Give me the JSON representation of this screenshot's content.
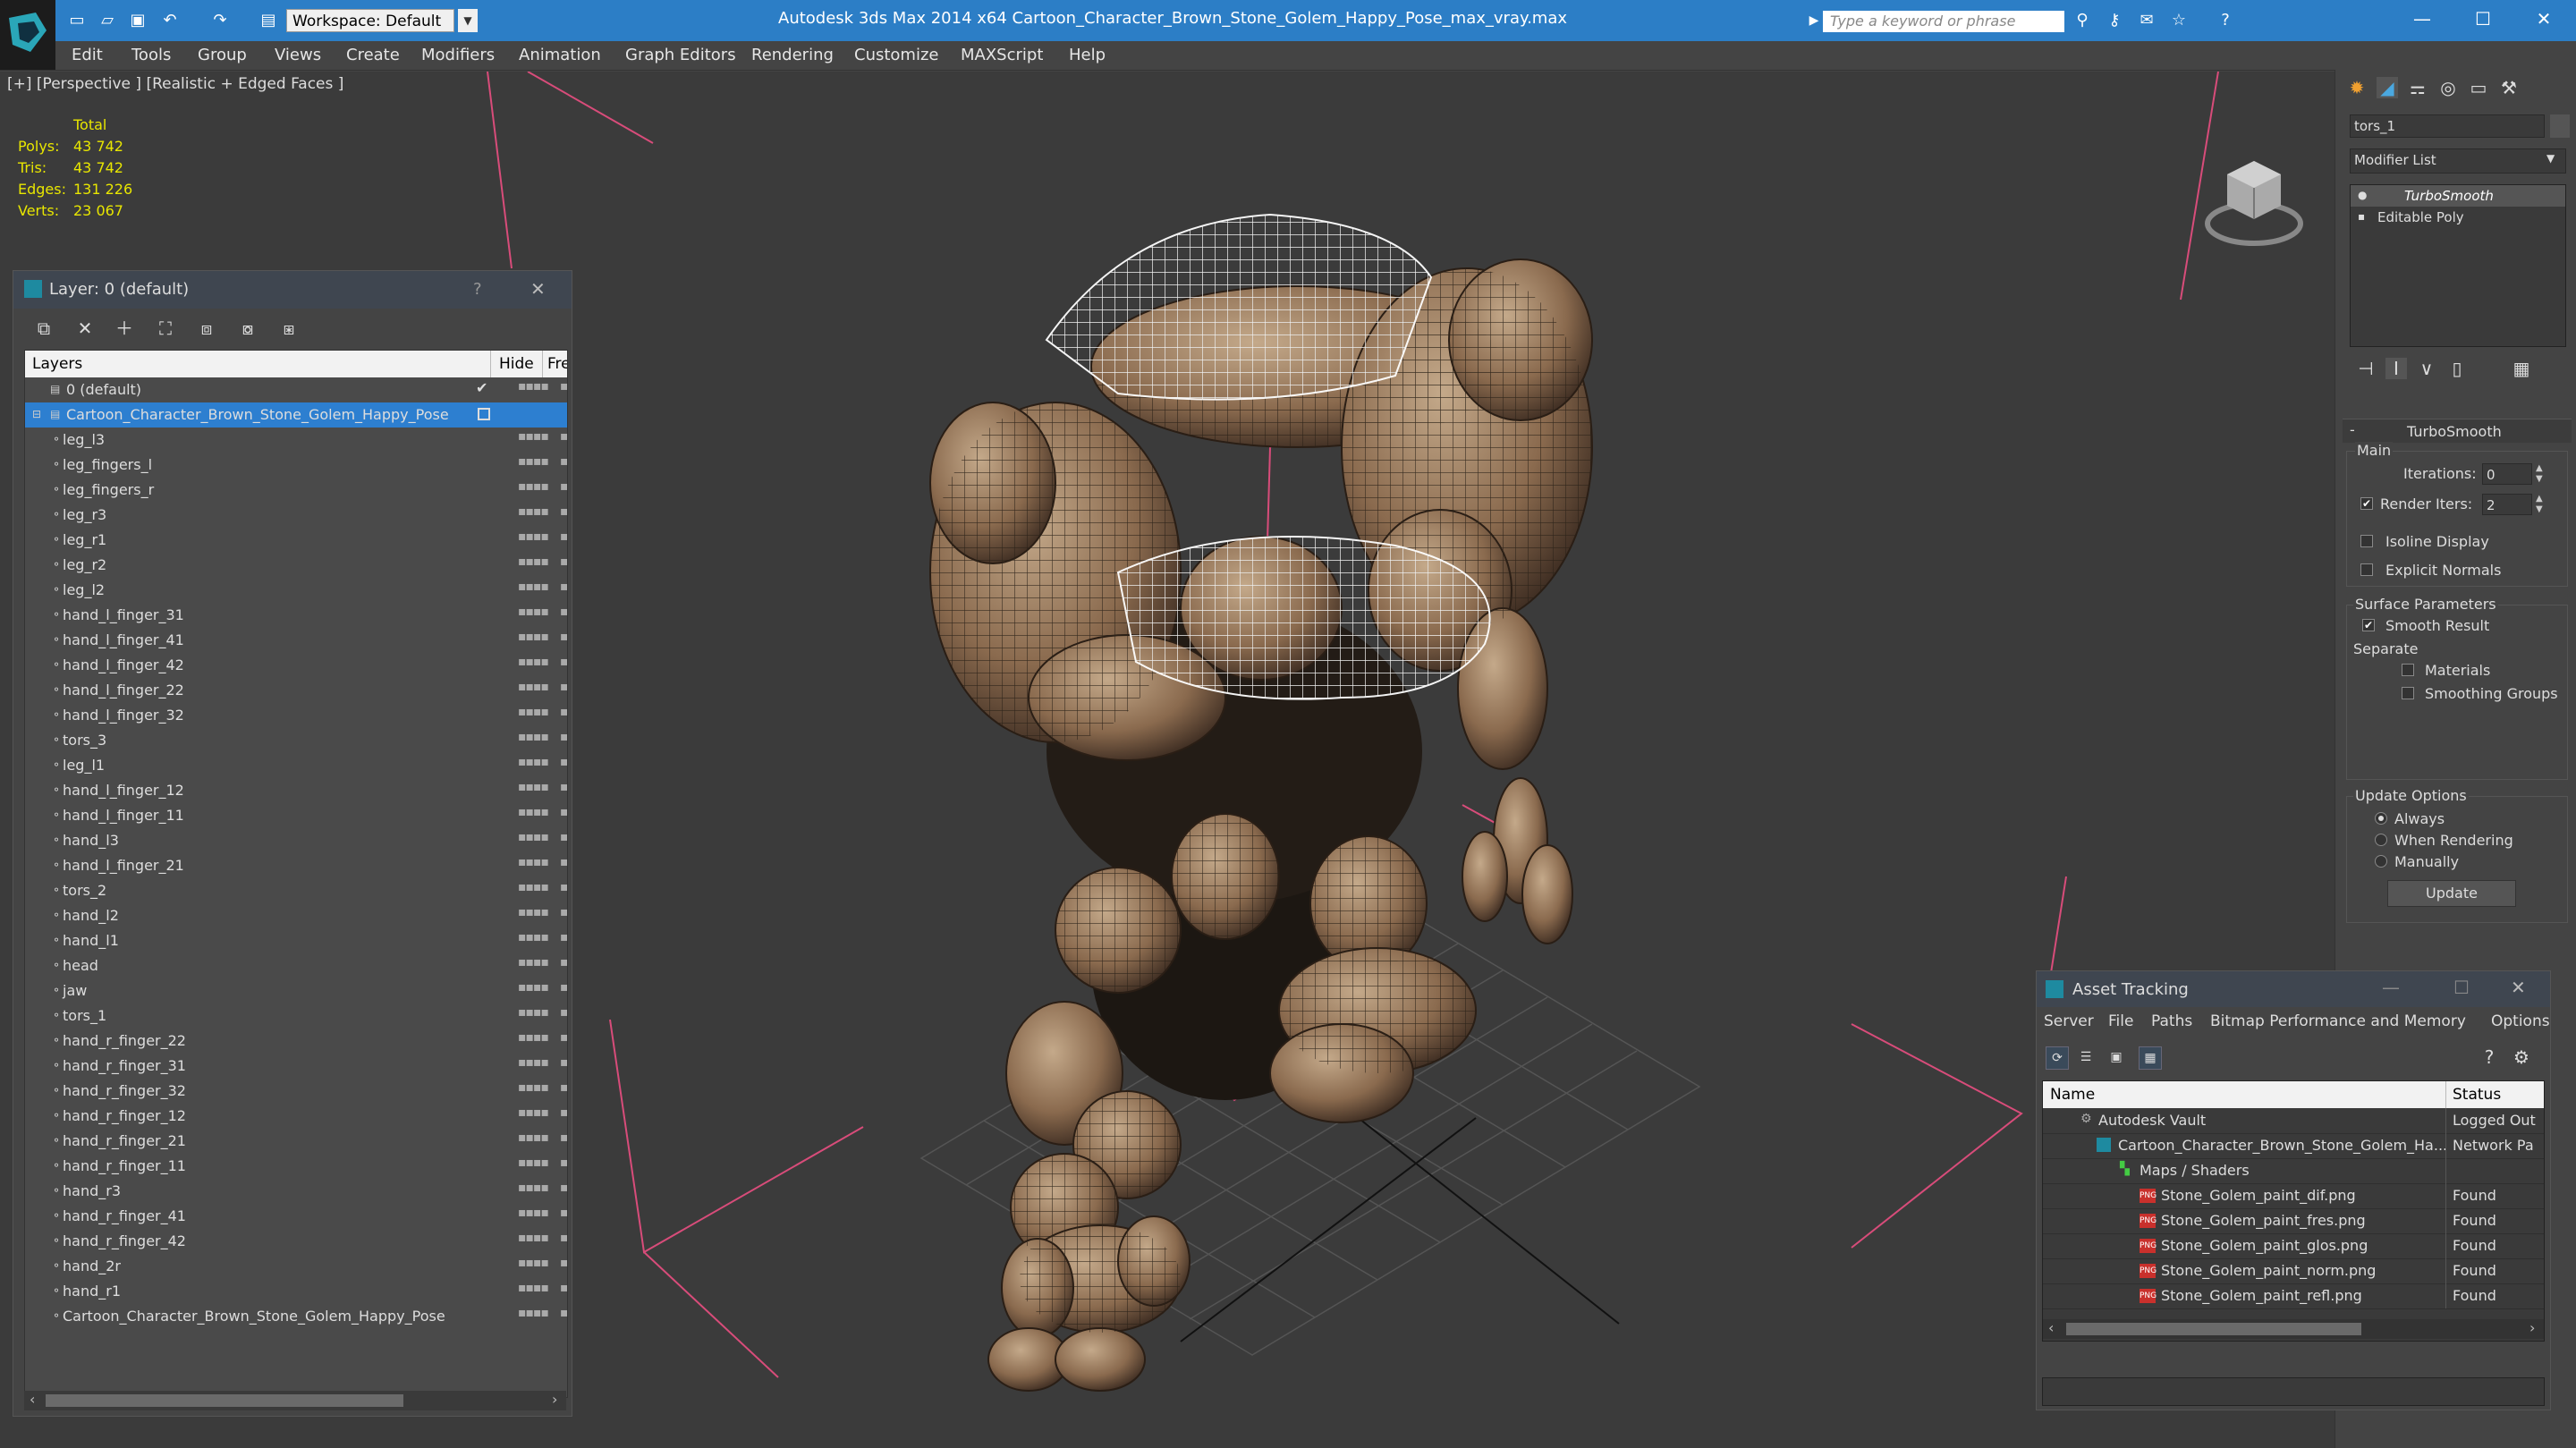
{
  "app": {
    "title": "Autodesk 3ds Max  2014 x64      Cartoon_Character_Brown_Stone_Golem_Happy_Pose_max_vray.max",
    "workspace": "Workspace: Default",
    "search_placeholder": "Type a keyword or phrase"
  },
  "menu": [
    "Edit",
    "Tools",
    "Group",
    "Views",
    "Create",
    "Modifiers",
    "Animation",
    "Graph Editors",
    "Rendering",
    "Customize",
    "MAXScript",
    "Help"
  ],
  "viewport": {
    "label": "[+] [Perspective ] [Realistic + Edged Faces ]",
    "stats": {
      "total_label": "Total",
      "rows": [
        {
          "label": "Polys:",
          "value": "43 742"
        },
        {
          "label": "Tris:",
          "value": "43 742"
        },
        {
          "label": "Edges:",
          "value": "131 226"
        },
        {
          "label": "Verts:",
          "value": "23 067"
        }
      ]
    }
  },
  "layer_panel": {
    "title": "Layer: 0 (default)",
    "help": "?",
    "columns": {
      "layers": "Layers",
      "hide": "Hide",
      "freeze": "Fre"
    },
    "default_layer": "0 (default)",
    "selected_layer": "Cartoon_Character_Brown_Stone_Golem_Happy_Pose",
    "objects": [
      "leg_l3",
      "leg_fingers_l",
      "leg_fingers_r",
      "leg_r3",
      "leg_r1",
      "leg_r2",
      "leg_l2",
      "hand_l_finger_31",
      "hand_l_finger_41",
      "hand_l_finger_42",
      "hand_l_finger_22",
      "hand_l_finger_32",
      "tors_3",
      "leg_l1",
      "hand_l_finger_12",
      "hand_l_finger_11",
      "hand_l3",
      "hand_l_finger_21",
      "tors_2",
      "hand_l2",
      "hand_l1",
      "head",
      "jaw",
      "tors_1",
      "hand_r_finger_22",
      "hand_r_finger_31",
      "hand_r_finger_32",
      "hand_r_finger_12",
      "hand_r_finger_21",
      "hand_r_finger_11",
      "hand_r3",
      "hand_r_finger_41",
      "hand_r_finger_42",
      "hand_2r",
      "hand_r1",
      "Cartoon_Character_Brown_Stone_Golem_Happy_Pose"
    ]
  },
  "command_panel": {
    "object_name": "tors_1",
    "modifier_list": "Modifier List",
    "stack": [
      "TurboSmooth",
      "Editable Poly"
    ],
    "rollout_title": "TurboSmooth",
    "main_label": "Main",
    "iterations_label": "Iterations:",
    "iterations_value": "0",
    "render_iters_label": "Render Iters:",
    "render_iters_value": "2",
    "isoline": "Isoline Display",
    "explicit_normals": "Explicit Normals",
    "surface_params": "Surface Parameters",
    "smooth_result": "Smooth Result",
    "separate": "Separate",
    "materials": "Materials",
    "smoothing_groups": "Smoothing Groups",
    "update_options": "Update Options",
    "always": "Always",
    "when_rendering": "When Rendering",
    "manually": "Manually",
    "update_button": "Update"
  },
  "asset_tracking": {
    "title": "Asset Tracking",
    "menu": [
      "Server",
      "File",
      "Paths",
      "Bitmap Performance and Memory",
      "Options"
    ],
    "columns": {
      "name": "Name",
      "status": "Status"
    },
    "rows": [
      {
        "name": "Autodesk Vault",
        "status": "Logged Out"
      },
      {
        "name": "Cartoon_Character_Brown_Stone_Golem_Ha...",
        "status": "Network Pa"
      },
      {
        "name": "Maps / Shaders",
        "status": ""
      },
      {
        "name": "Stone_Golem_paint_dif.png",
        "status": "Found"
      },
      {
        "name": "Stone_Golem_paint_fres.png",
        "status": "Found"
      },
      {
        "name": "Stone_Golem_paint_glos.png",
        "status": "Found"
      },
      {
        "name": "Stone_Golem_paint_norm.png",
        "status": "Found"
      },
      {
        "name": "Stone_Golem_paint_refl.png",
        "status": "Found"
      }
    ]
  },
  "colors": {
    "titlebar": "#2c7ec6",
    "selection": "#2d7fd0",
    "stats_yellow": "#e8e600",
    "bbox_pink": "#d84c7a"
  }
}
